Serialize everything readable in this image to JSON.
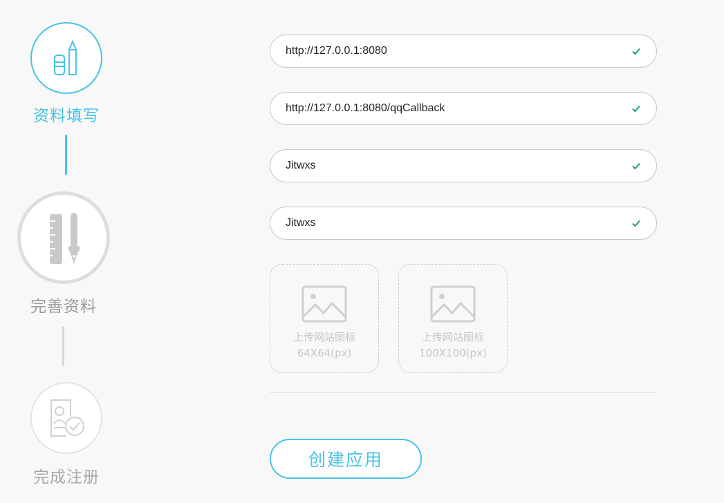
{
  "steps": [
    {
      "label": "资料填写",
      "state": "active",
      "icon": "eraser-pencil-icon"
    },
    {
      "label": "完善资料",
      "state": "pending",
      "icon": "ruler-pen-icon"
    },
    {
      "label": "完成注册",
      "state": "pending",
      "icon": "profile-check-icon"
    }
  ],
  "form": {
    "fields": [
      {
        "value": "http://127.0.0.1:8080",
        "valid": true
      },
      {
        "value": "http://127.0.0.1:8080/qqCallback",
        "valid": true
      },
      {
        "value": "Jitwxs",
        "valid": true
      },
      {
        "value": "Jitwxs",
        "valid": true
      }
    ],
    "uploads": [
      {
        "title": "上传网站图标",
        "size": "64X64(px)",
        "icon": "image-placeholder-icon"
      },
      {
        "title": "上传网站图标",
        "size": "100X100(px)",
        "icon": "image-placeholder-icon"
      }
    ],
    "submit_label": "创建应用"
  },
  "colors": {
    "accent": "#45c4e6",
    "valid": "#1aa16a",
    "inactive": "#d8d8d8",
    "muted_text": "#c6c6c6"
  }
}
